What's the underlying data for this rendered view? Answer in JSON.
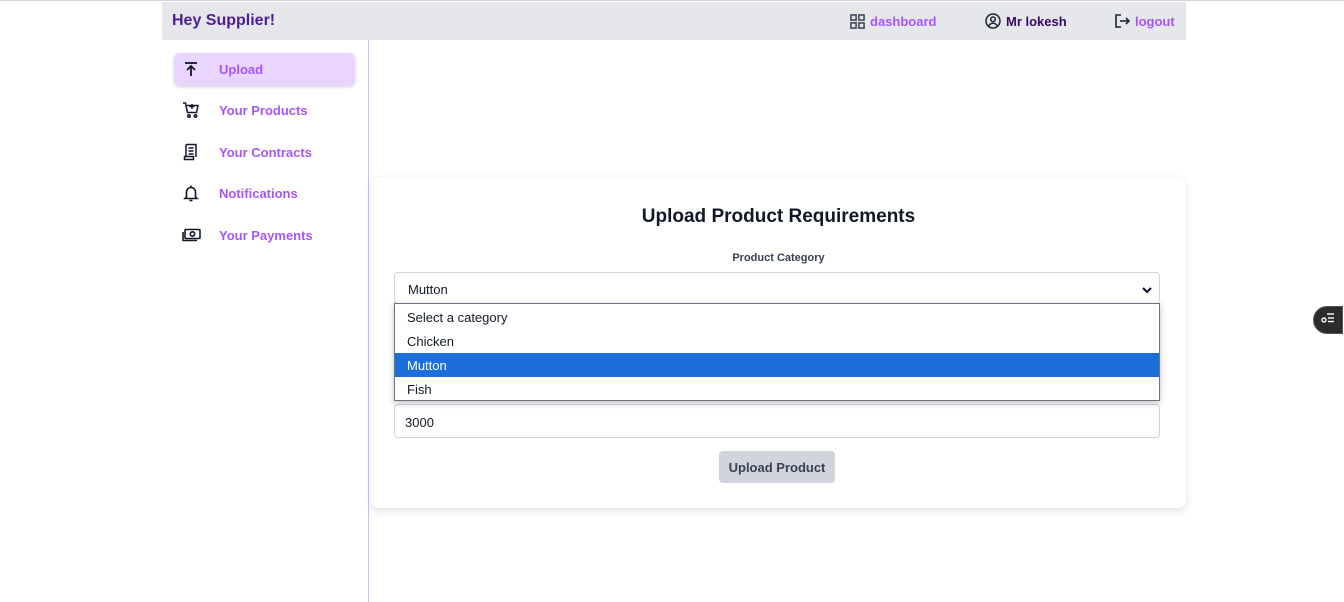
{
  "header": {
    "brand": "Hey Supplier!",
    "dashboard_label": "dashboard",
    "user_label": "Mr lokesh",
    "logout_label": "logout"
  },
  "sidebar": {
    "items": [
      {
        "label": "Upload",
        "icon": "upload-icon",
        "active": true
      },
      {
        "label": "Your Products",
        "icon": "cart-icon",
        "active": false
      },
      {
        "label": "Your Contracts",
        "icon": "document-icon",
        "active": false
      },
      {
        "label": "Notifications",
        "icon": "bell-icon",
        "active": false
      },
      {
        "label": "Your Payments",
        "icon": "money-icon",
        "active": false
      }
    ]
  },
  "form": {
    "title": "Upload Product Requirements",
    "category_label": "Product Category",
    "category_value": "Mutton",
    "category_options": [
      "Select a category",
      "Chicken",
      "Mutton",
      "Fish"
    ],
    "selected_option_index": 2,
    "amount_value": "3000",
    "submit_label": "Upload Product"
  },
  "colors": {
    "accent": "#a855f7",
    "brand": "#4c1d95",
    "active_bg": "#e9d5ff",
    "header_bg": "#e5e7eb",
    "option_selected": "#1a6fd8"
  }
}
